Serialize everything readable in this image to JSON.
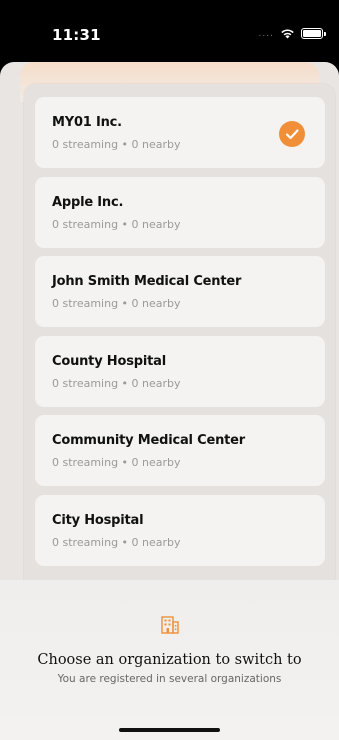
{
  "status_bar": {
    "time": "11:31",
    "signal": "....",
    "icons": [
      "wifi-icon",
      "battery-icon"
    ]
  },
  "organizations": [
    {
      "name": "MY01 Inc.",
      "meta": "0 streaming • 0 nearby",
      "selected": true
    },
    {
      "name": "Apple Inc.",
      "meta": "0 streaming • 0 nearby",
      "selected": false
    },
    {
      "name": "John Smith Medical Center",
      "meta": "0 streaming • 0 nearby",
      "selected": false
    },
    {
      "name": "County Hospital",
      "meta": "0 streaming • 0 nearby",
      "selected": false
    },
    {
      "name": "Community Medical Center",
      "meta": "0 streaming • 0 nearby",
      "selected": false
    },
    {
      "name": "City Hospital",
      "meta": "0 streaming • 0 nearby",
      "selected": false
    }
  ],
  "footer": {
    "icon": "building-icon",
    "title": "Choose an organization to switch to",
    "subtitle": "You are registered in several organizations"
  },
  "colors": {
    "accent": "#f08f38",
    "card": "#f4f3f2",
    "background": "#e9e5e3"
  }
}
